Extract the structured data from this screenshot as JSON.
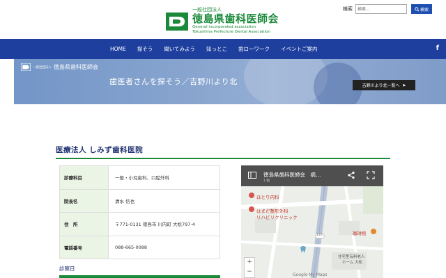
{
  "header": {
    "logo_small": "一般社団法人",
    "logo_main": "徳島県歯科医師会",
    "logo_en_1": "General incorporated association",
    "logo_en_2": "Tokushima Prefecture Dental Association",
    "search_label": "検索",
    "search_placeholder": "検索...",
    "search_button": "検索"
  },
  "nav": {
    "items": [
      "HOME",
      "探そう",
      "聞いてみよう",
      "知っとこ",
      "歯ローワーク",
      "イベントご案内"
    ],
    "facebook": "f"
  },
  "hero": {
    "logo_small": "一般社団法人",
    "logo_main": "徳島県歯科医師会",
    "title": "歯医者さんを探そう／吉野川より北",
    "button": "吉野川より北一覧へ"
  },
  "clinic": {
    "name": "医療法人 しみず歯科医院",
    "rows": [
      {
        "label": "診療科目",
        "value": "一般・小児歯科、口腔外科"
      },
      {
        "label": "院長名",
        "value": "清水 信也"
      },
      {
        "label": "住　所",
        "value": "〒771-0131 徳島市 川内町 大松797-4"
      },
      {
        "label": "電話番号",
        "value": "088-665-0088"
      }
    ],
    "hours_label": "診察日"
  },
  "map": {
    "title": "徳島県歯科医師会　病…",
    "subtitle": "1 個",
    "labels": {
      "clinic1": "ほとり内科",
      "clinic2": "はまだ整形外科",
      "clinic3": "リハビリクリニック",
      "cafe": "珈琲館",
      "home1": "住宅型有料老人",
      "home2": "ホーム 大松",
      "route": "120"
    },
    "zoom_in": "+",
    "zoom_out": "−",
    "footer": "Google My Maps"
  },
  "colors": {
    "brand_green": "#1a8a3a",
    "nav_blue": "#1e3f9e",
    "title_navy": "#1e3070",
    "search_blue": "#1e4fb0"
  }
}
